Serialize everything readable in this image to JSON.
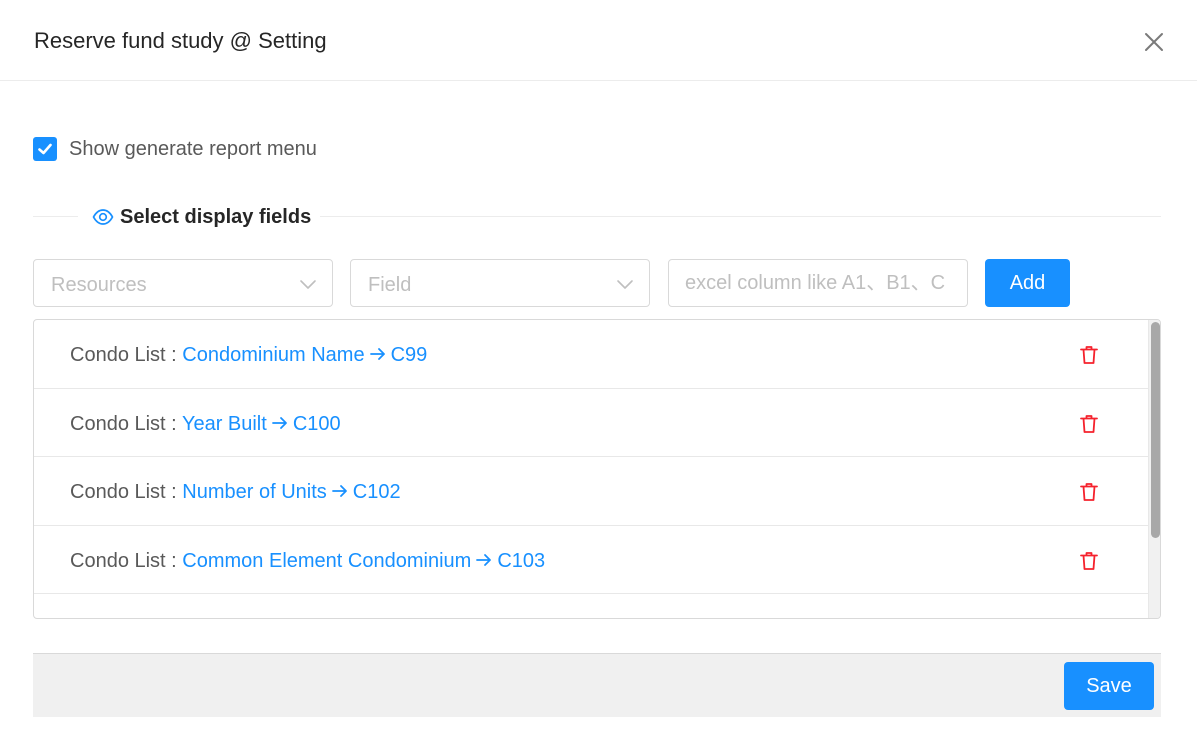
{
  "dialog": {
    "title": "Reserve fund study @ Setting"
  },
  "options": {
    "show_report_menu_label": "Show generate report menu",
    "show_report_menu_checked": true
  },
  "section": {
    "title": "Select display fields"
  },
  "form": {
    "resources_placeholder": "Resources",
    "field_placeholder": "Field",
    "column_placeholder": "excel column like A1、B1、C",
    "add_label": "Add"
  },
  "fields": [
    {
      "prefix": "Condo List : ",
      "field": "Condominium Name",
      "column": "C99"
    },
    {
      "prefix": "Condo List : ",
      "field": "Year Built",
      "column": "C100"
    },
    {
      "prefix": "Condo List : ",
      "field": "Number of Units",
      "column": "C102"
    },
    {
      "prefix": "Condo List : ",
      "field": "Common Element Condominium",
      "column": "C103"
    }
  ],
  "footer": {
    "save_label": "Save"
  },
  "colors": {
    "primary": "#1890ff",
    "danger": "#f5222d"
  },
  "icons": {
    "close": "close-icon",
    "check": "check-icon",
    "eye": "eye-icon",
    "chevron": "chevron-down-icon",
    "arrow": "arrow-right-icon",
    "delete": "trash-icon"
  }
}
